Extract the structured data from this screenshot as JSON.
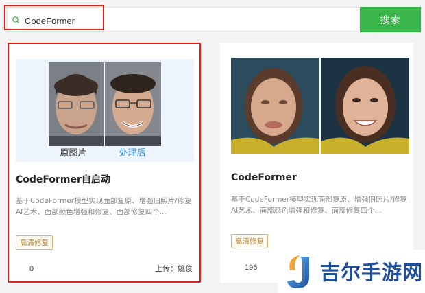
{
  "search": {
    "value": "CodeFormer",
    "button_label": "搜索"
  },
  "cards": [
    {
      "title": "CodeFormer自启动",
      "description": "基于CodeFormer模型实现面部复原、增强旧照片/修复AI艺术、面部颜色增强和修复、面部修复四个...",
      "tag": "高清修复",
      "count": "0",
      "uploader": "上传：姚俊",
      "image_labels": {
        "before": "原图片",
        "after": "处理后"
      }
    },
    {
      "title": "CodeFormer",
      "description": "基于CodeFormer模型实现面部复原、增强旧照片/修复AI艺术、面部颜色增强和修复、面部修复四个...",
      "tag": "高清修复",
      "count": "196"
    }
  ],
  "watermark": {
    "text": "吉尔手游网"
  },
  "colors": {
    "accent_green": "#3ab54a",
    "highlight_red": "#d9241c",
    "brand_blue": "#1f4f9b"
  }
}
